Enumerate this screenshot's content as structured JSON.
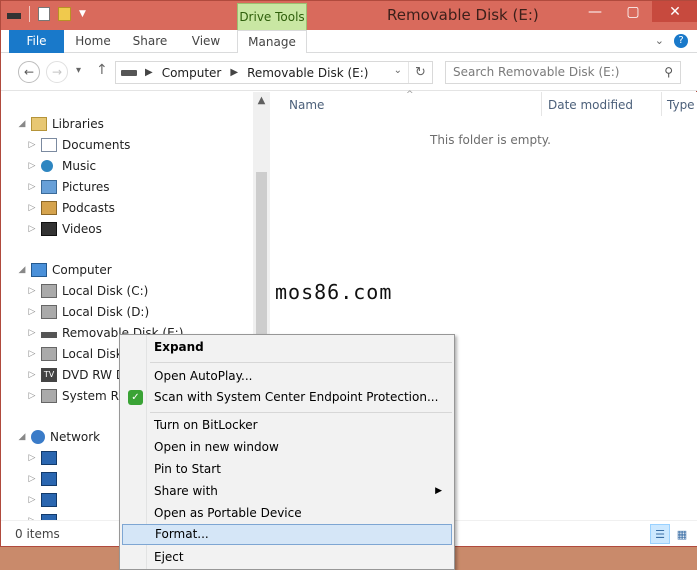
{
  "window": {
    "title": "Removable Disk (E:)",
    "contextual_tab_group": "Drive Tools",
    "controls": {
      "minimize": "—",
      "maximize": "▢",
      "close": "✕"
    }
  },
  "ribbon": {
    "tabs": [
      "File",
      "Home",
      "Share",
      "View",
      "Manage"
    ],
    "file_tab_color": "#1979ca"
  },
  "addressbar": {
    "crumbs": [
      "Computer",
      "Removable Disk (E:)"
    ],
    "search_placeholder": "Search Removable Disk (E:)"
  },
  "navpane": {
    "libraries": {
      "label": "Libraries",
      "items": [
        "Documents",
        "Music",
        "Pictures",
        "Podcasts",
        "Videos"
      ]
    },
    "computer": {
      "label": "Computer",
      "items": [
        "Local Disk (C:)",
        "Local Disk (D:)",
        "Removable Disk (E:)",
        "Local Disk (",
        "DVD RW Dri",
        "System Reso"
      ]
    },
    "network": {
      "label": "Network"
    }
  },
  "content": {
    "columns": {
      "name": "Name",
      "date_modified": "Date modified",
      "type": "Type"
    },
    "empty_message": "This folder is empty."
  },
  "status": {
    "items_count": "0 items"
  },
  "watermark": "mos86.com",
  "context_menu": {
    "items": {
      "expand": "Expand",
      "open_autoplay": "Open AutoPlay...",
      "scan": "Scan with System Center Endpoint Protection...",
      "bitlocker": "Turn on BitLocker",
      "open_new_window": "Open in new window",
      "pin_to_start": "Pin to Start",
      "share_with": "Share with",
      "portable_device": "Open as Portable Device",
      "format": "Format...",
      "eject": "Eject"
    }
  }
}
